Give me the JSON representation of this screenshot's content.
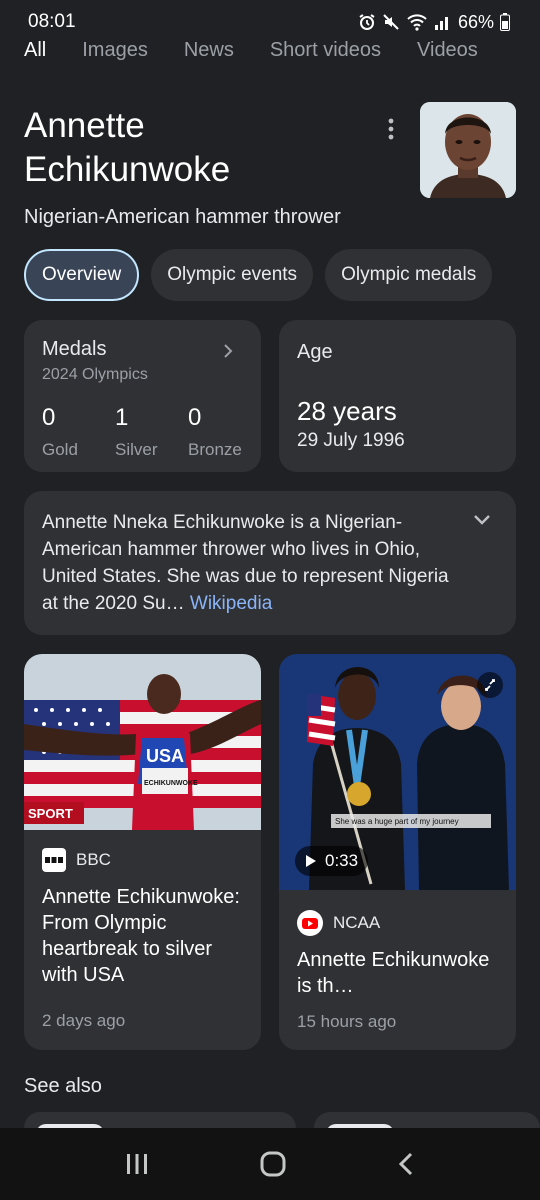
{
  "status": {
    "time": "08:01",
    "battery": "66%"
  },
  "tabs": [
    "All",
    "Images",
    "News",
    "Short videos",
    "Videos"
  ],
  "entity": {
    "name_line1": "Annette",
    "name_line2": "Echikunwoke",
    "subtitle": "Nigerian-American hammer thrower"
  },
  "chips": [
    "Overview",
    "Olympic events",
    "Olympic medals"
  ],
  "medals": {
    "title": "Medals",
    "subtitle": "2024 Olympics",
    "items": [
      {
        "count": "0",
        "label": "Gold"
      },
      {
        "count": "1",
        "label": "Silver"
      },
      {
        "count": "0",
        "label": "Bronze"
      }
    ]
  },
  "age": {
    "title": "Age",
    "value": "28 years",
    "dob": "29 July 1996"
  },
  "description": {
    "text": "Annette Nneka Echikunwoke is a Nigerian-American hammer thrower who lives in Ohio, United States. She was due to represent Nigeria at the 2020 Su…",
    "link": "Wikipedia"
  },
  "news": [
    {
      "source": "BBC",
      "image_text": [
        "USA",
        "ECHIKUNWOKE",
        "SPORT"
      ],
      "headline": "Annette Echikunwoke: From Olympic heartbreak to silver with USA",
      "time": "2 days ago"
    },
    {
      "source": "NCAA",
      "duration": "0:33",
      "caption": "She was a huge part of my journey",
      "headline": "Annette Echikunwoke is th…",
      "time": "15 hours ago"
    }
  ],
  "see_also": "See also",
  "colors": {
    "background": "#202124",
    "card": "#303134",
    "link": "#8ab4f8",
    "chip_active_border": "#c2e7ff"
  }
}
